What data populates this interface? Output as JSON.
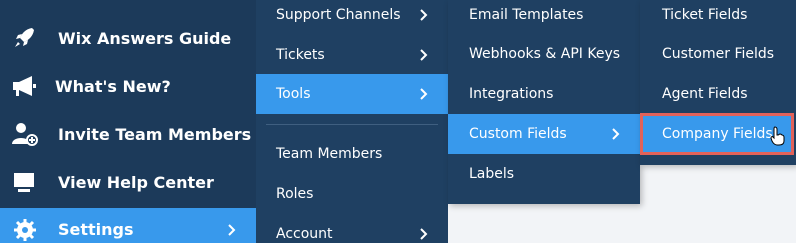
{
  "sidebar": {
    "items": [
      {
        "label": "Wix Answers Guide",
        "icon": "rocket-icon"
      },
      {
        "label": "What's New?",
        "icon": "megaphone-icon"
      },
      {
        "label": "Invite Team Members",
        "icon": "add-user-icon"
      },
      {
        "label": "View Help Center",
        "icon": "monitor-icon"
      },
      {
        "label": "Settings",
        "icon": "gear-icon"
      }
    ]
  },
  "menu2": {
    "items": [
      {
        "label": "Support Channels"
      },
      {
        "label": "Tickets"
      },
      {
        "label": "Tools"
      },
      {
        "label": "Team Members"
      },
      {
        "label": "Roles"
      },
      {
        "label": "Account"
      }
    ]
  },
  "menu3": {
    "items": [
      {
        "label": "Email Templates"
      },
      {
        "label": "Webhooks & API Keys"
      },
      {
        "label": "Integrations"
      },
      {
        "label": "Custom Fields"
      },
      {
        "label": "Labels"
      }
    ]
  },
  "menu4": {
    "items": [
      {
        "label": "Ticket Fields"
      },
      {
        "label": "Customer Fields"
      },
      {
        "label": "Agent Fields"
      },
      {
        "label": "Company Fields"
      }
    ]
  },
  "colors": {
    "sidebar_bg": "#1c3a5a",
    "menu_bg": "#1f4062",
    "accent": "#3899ec",
    "highlight_border": "#e2625a"
  }
}
